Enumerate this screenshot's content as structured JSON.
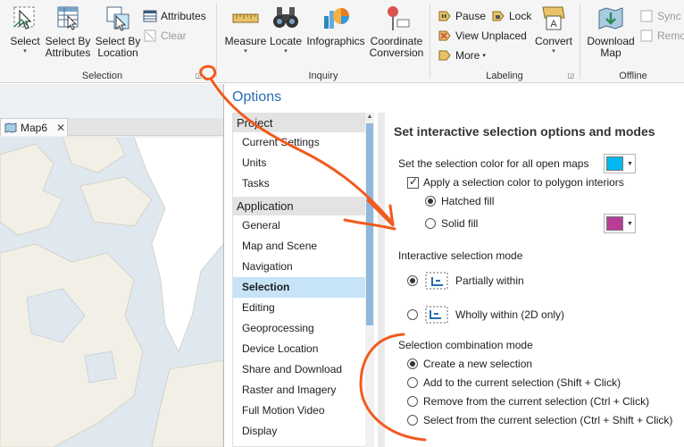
{
  "ribbon": {
    "selection_group": {
      "label": "Selection",
      "select": "Select",
      "select_by_attributes": [
        "Select By",
        "Attributes"
      ],
      "select_by_location": [
        "Select By",
        "Location"
      ],
      "attributes": "Attributes",
      "clear": "Clear"
    },
    "inquiry_group": {
      "label": "Inquiry",
      "measure": "Measure",
      "locate": "Locate",
      "infographics": "Infographics",
      "coordinate_conversion": [
        "Coordinate",
        "Conversion"
      ]
    },
    "labeling_group": {
      "label": "Labeling",
      "pause": "Pause",
      "lock": "Lock",
      "view_unplaced": "View Unplaced",
      "more": "More",
      "convert": "Convert"
    },
    "offline_group": {
      "label": "Offline",
      "download_map": [
        "Download",
        "Map"
      ],
      "sync": "Sync",
      "remove": "Remo"
    }
  },
  "map_view": {
    "tab_label": "Map6",
    "close_glyph": "✕"
  },
  "dialog": {
    "title": "Options",
    "nav": {
      "project_header": "Project",
      "project_items": [
        "Current Settings",
        "Units",
        "Tasks"
      ],
      "application_header": "Application",
      "application_items": [
        "General",
        "Map and Scene",
        "Navigation",
        "Selection",
        "Editing",
        "Geoprocessing",
        "Device Location",
        "Share and Download",
        "Raster and Imagery",
        "Full Motion Video",
        "Display"
      ],
      "selected_item": "Selection"
    },
    "panel": {
      "heading": "Set interactive selection options and modes",
      "selection_color_label": "Set the selection color for all open maps",
      "selection_color": "#00b7f1",
      "apply_polygon_label": "Apply a selection color to polygon interiors",
      "apply_polygon_checked": true,
      "hatched_fill": "Hatched fill",
      "solid_fill": "Solid fill",
      "fill_choice": "hatched",
      "solid_fill_color": "#b83d96",
      "interactive_mode_label": "Interactive selection mode",
      "partially_within": "Partially within",
      "wholly_within": "Wholly within (2D only)",
      "interactive_mode": "partially",
      "combination_mode_label": "Selection combination mode",
      "combination_options": [
        "Create a new selection",
        "Add to the current selection (Shift + Click)",
        "Remove from the current selection (Ctrl + Click)",
        "Select from the current selection (Ctrl + Shift + Click)"
      ],
      "combination_selected_index": 0
    }
  },
  "annotation_color": "#f25a1e",
  "accent_color": "#2b6cb0"
}
